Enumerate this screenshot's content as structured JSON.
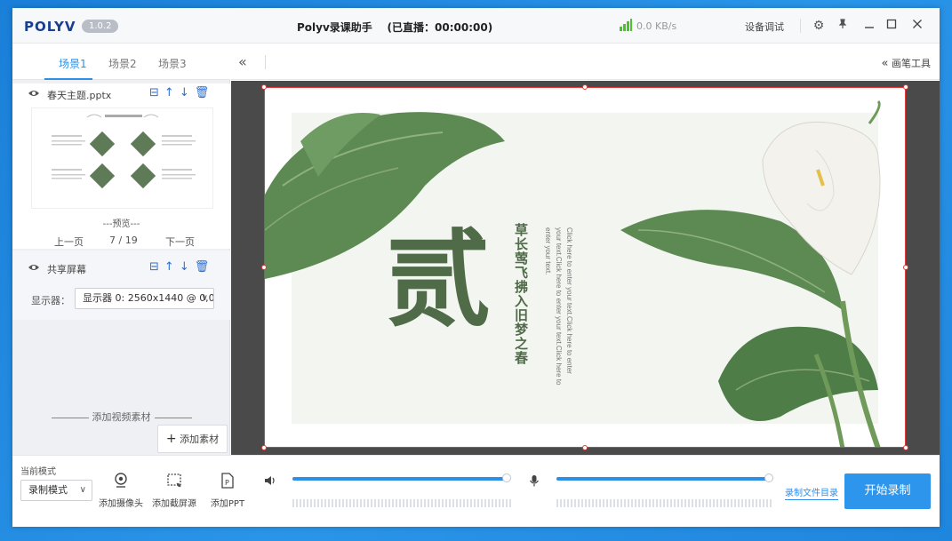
{
  "titlebar": {
    "logo": "POLYV",
    "version": "1.0.2",
    "title": "Polyv录课助手    (已直播：00:00:00)",
    "net_speed": "0.0 KB/s",
    "device_test": "设备调试",
    "icons": [
      "gear-icon",
      "pin-icon",
      "minimize-icon",
      "maximize-icon",
      "close-icon"
    ],
    "signal_color": "#4cc32a"
  },
  "scenes": {
    "tabs": [
      "场景1",
      "场景2",
      "场景3"
    ],
    "active": 0
  },
  "sources": [
    {
      "name": "春天主题.pptx",
      "preview_label": "---预览---",
      "prev": "上一页",
      "page": "7 / 19",
      "next": "下一页"
    },
    {
      "name": "共享屏幕",
      "display_label": "显示器：",
      "display_value": "显示器 0: 2560x1440 @ 0,0"
    }
  ],
  "left_footer": {
    "add_video": "添加视频素材",
    "add_material": "添加素材"
  },
  "right_toolbar": {
    "pen_tools": "画笔工具"
  },
  "slide": {
    "big_char": "贰",
    "vertical_title": "草长莺飞拂入旧梦之春",
    "vertical_body": "Click here to enter your text.Click here to enter your text.Click here to enter your text.Click here to enter your text."
  },
  "bottom": {
    "mode_label": "当前模式",
    "mode_value": "录制模式",
    "add_camera": "添加摄像头",
    "add_capture": "添加截屏源",
    "add_ppt": "添加PPT",
    "speaker_level": 1.0,
    "mic_level": 1.0,
    "record_dir": "录制文件目录",
    "start_record": "开始录制"
  },
  "accent_color": "#2d95ec"
}
